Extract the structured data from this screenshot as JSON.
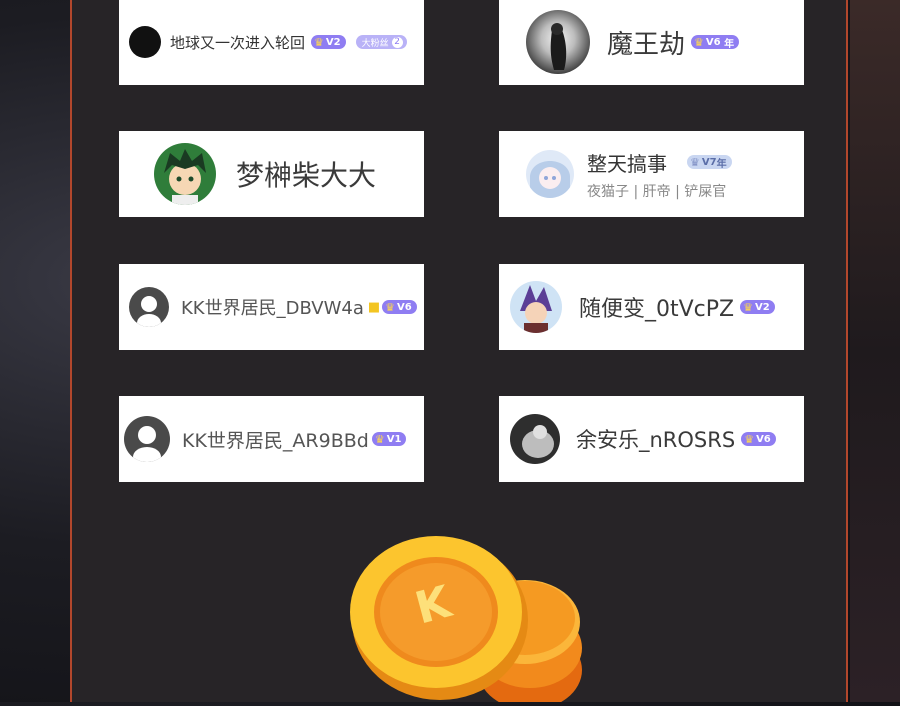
{
  "cards": [
    {
      "name": "地球又一次进入轮回",
      "level": "V2",
      "fan_label": "大粉丝",
      "fan_num": "2"
    },
    {
      "name": "魔王劫",
      "level": "V6",
      "year": "年"
    },
    {
      "name": "梦榊柴大大"
    },
    {
      "name": "整天搞事",
      "level": "V7",
      "year": "年",
      "tags": "夜猫子 | 肝帝 | 铲屎官"
    },
    {
      "name": "KK世界居民_DBVW4a",
      "level": "V6"
    },
    {
      "name": "随便变_0tVcPZ",
      "level": "V2"
    },
    {
      "name": "KK世界居民_AR9BBd",
      "level": "V1"
    },
    {
      "name": "余安乐_nROSRS",
      "level": "V6"
    }
  ],
  "coin": {
    "letter": "K",
    "color": "#f7b021"
  },
  "colors": {
    "accent_border": "#b2472c",
    "badge": "#8f7df2"
  }
}
